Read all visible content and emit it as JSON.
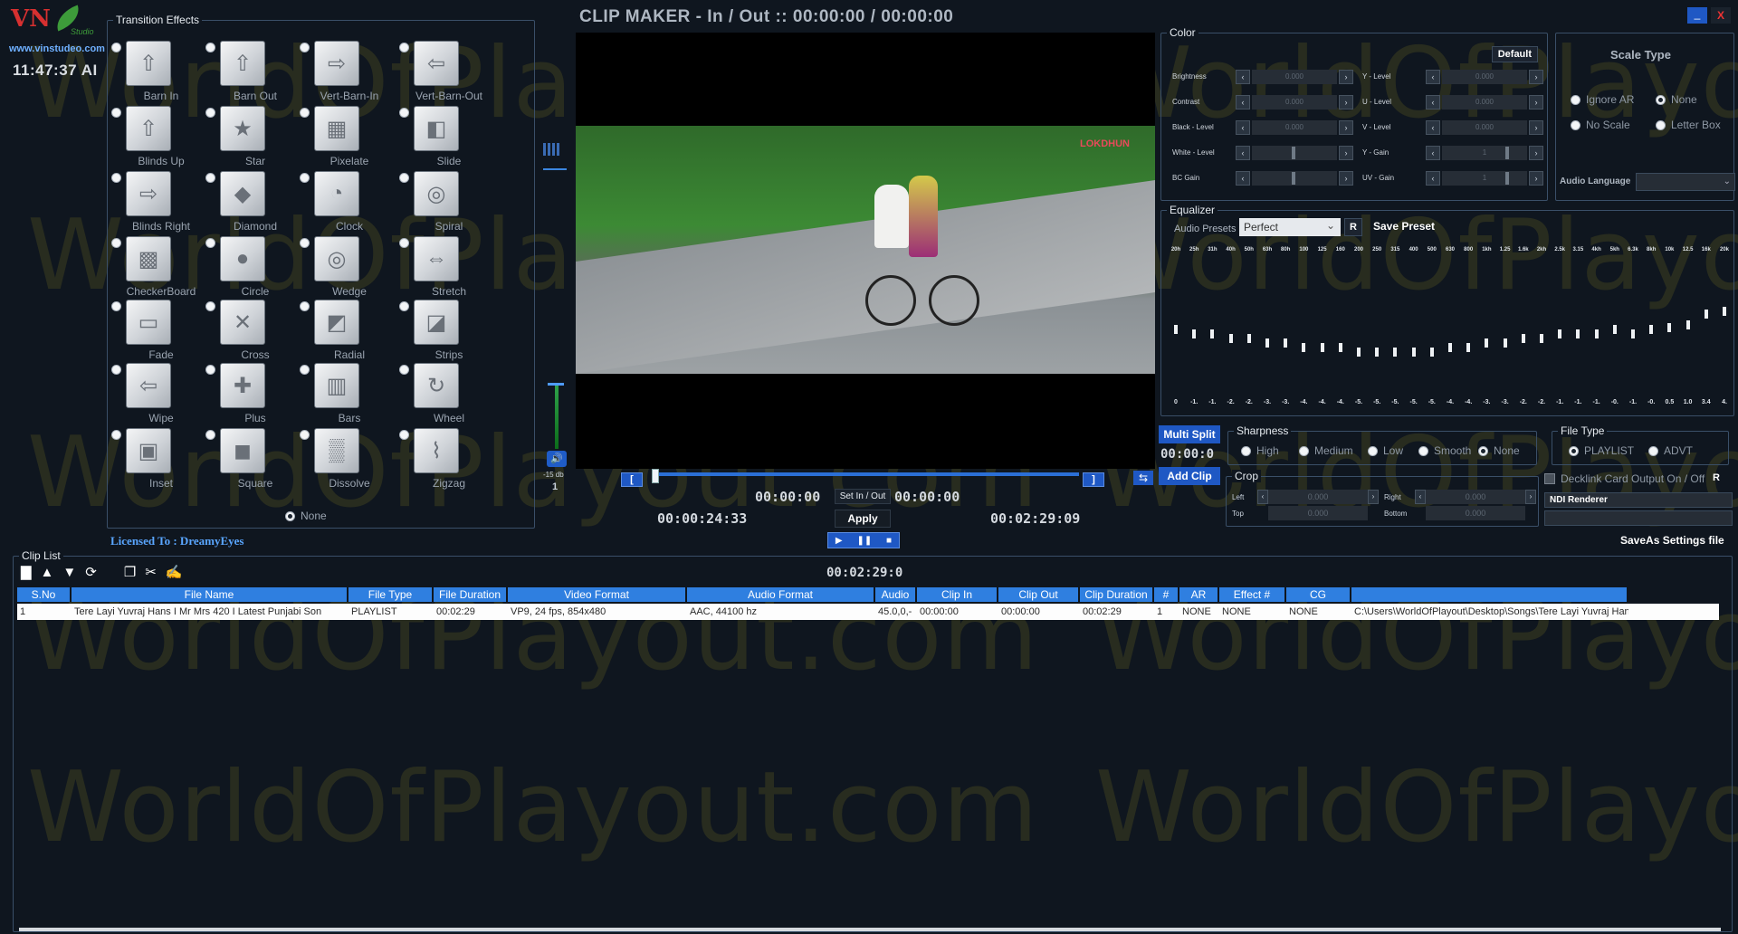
{
  "app": {
    "title": "CLIP MAKER  -  In / Out  ::  00:00:00 / 00:00:00",
    "logo_text": "VN",
    "logo_sub": "Studio",
    "url": "www.vinstudeo.com",
    "clock": "11:47:37 AI",
    "licensed": "Licensed To : DreamyEyes",
    "watermark": "WorldOfPlayout.com",
    "accent": "#1f58c4",
    "header_blue": "#2f7fe0"
  },
  "transition_effects": {
    "legend": "Transition Effects",
    "items": [
      {
        "label": "Barn In",
        "icon": "arrow-up-icon"
      },
      {
        "label": "Barn Out",
        "icon": "arrow-up-icon"
      },
      {
        "label": "Vert-Barn-In",
        "icon": "arrow-right-icon"
      },
      {
        "label": "Vert-Barn-Out",
        "icon": "arrow-left-icon"
      },
      {
        "label": "Blinds Up",
        "icon": "arrow-up-icon"
      },
      {
        "label": "Star",
        "icon": "star-icon"
      },
      {
        "label": "Pixelate",
        "icon": "checker-icon"
      },
      {
        "label": "Slide",
        "icon": "slide-icon"
      },
      {
        "label": "Blinds Right",
        "icon": "arrow-right-icon"
      },
      {
        "label": "Diamond",
        "icon": "diamond-icon"
      },
      {
        "label": "Clock",
        "icon": "clock-icon"
      },
      {
        "label": "Spiral",
        "icon": "spiral-icon"
      },
      {
        "label": "CheckerBoard",
        "icon": "checkerboard-icon"
      },
      {
        "label": "Circle",
        "icon": "circle-icon"
      },
      {
        "label": "Wedge",
        "icon": "wedge-icon"
      },
      {
        "label": "Stretch",
        "icon": "stretch-icon"
      },
      {
        "label": "Fade",
        "icon": "fade-icon"
      },
      {
        "label": "Cross",
        "icon": "cross-icon"
      },
      {
        "label": "Radial",
        "icon": "radial-icon"
      },
      {
        "label": "Strips",
        "icon": "strips-icon"
      },
      {
        "label": "Wipe",
        "icon": "arrow-left-icon"
      },
      {
        "label": "Plus",
        "icon": "plus-icon"
      },
      {
        "label": "Bars",
        "icon": "bars-icon"
      },
      {
        "label": "Wheel",
        "icon": "wheel-icon"
      },
      {
        "label": "Inset",
        "icon": "inset-icon"
      },
      {
        "label": "Square",
        "icon": "square-icon"
      },
      {
        "label": "Dissolve",
        "icon": "dissolve-icon"
      },
      {
        "label": "Zigzag",
        "icon": "zigzag-icon"
      }
    ],
    "none_label": "None"
  },
  "video": {
    "channel_logo": "LOKDHUN"
  },
  "audio_meter": {
    "db_label": "-15 db",
    "level": "1"
  },
  "transport": {
    "in_marker": "[",
    "out_marker": "]",
    "clip_in_tc": "00:00:00",
    "clip_out_tc": "00:00:00",
    "set_in_out": "Set In / Out",
    "current_tc": "00:00:24:33",
    "duration_tc": "00:02:29:09",
    "apply": "Apply",
    "play": "▶",
    "pause": "❚❚",
    "stop": "■",
    "multi_split": "Multi Split",
    "split_tc": "00:00:0",
    "add_clip": "Add Clip"
  },
  "color": {
    "legend": "Color",
    "default": "Default",
    "left": [
      {
        "label": "Brightness",
        "value": "0.000"
      },
      {
        "label": "Contrast",
        "value": "0.000"
      },
      {
        "label": "Black - Level",
        "value": "0.000"
      },
      {
        "label": "White - Level",
        "value": ""
      },
      {
        "label": "BC Gain",
        "value": ""
      }
    ],
    "right": [
      {
        "label": "Y - Level",
        "value": "0.000"
      },
      {
        "label": "U - Level",
        "value": "0.000"
      },
      {
        "label": "V - Level",
        "value": "0.000"
      },
      {
        "label": "Y - Gain",
        "value": "1"
      },
      {
        "label": "UV - Gain",
        "value": "1"
      }
    ]
  },
  "scale_type": {
    "title": "Scale Type",
    "options": [
      "Ignore AR",
      "None",
      "No Scale",
      "Letter Box"
    ],
    "selected": "None",
    "audio_language_label": "Audio Language",
    "audio_language_value": "⌄"
  },
  "equalizer": {
    "legend": "Equalizer",
    "presets_label": "Audio Presets",
    "preset": "Perfect",
    "r": "R",
    "save_preset": "Save Preset",
    "bands": [
      "20h",
      "25h",
      "31h",
      "40h",
      "50h",
      "63h",
      "80h",
      "100",
      "125",
      "160",
      "200",
      "250",
      "315",
      "400",
      "500",
      "630",
      "800",
      "1kh",
      "1.25",
      "1.6k",
      "2kh",
      "2.5k",
      "3.15",
      "4kh",
      "5kh",
      "6.3k",
      "8kh",
      "10k",
      "12.5",
      "16k",
      "20k"
    ],
    "values": [
      "0",
      "-1.",
      "-1.",
      "-2.",
      "-2.",
      "-3.",
      "-3.",
      "-4.",
      "-4.",
      "-4.",
      "-5.",
      "-5.",
      "-5.",
      "-5.",
      "-5.",
      "-4.",
      "-4.",
      "-3.",
      "-3.",
      "-2.",
      "-2.",
      "-1.",
      "-1.",
      "-1.",
      "-0.",
      "-1.",
      "-0.",
      "0.5",
      "1.0",
      "3.4",
      "4."
    ]
  },
  "sharpness": {
    "legend": "Sharpness",
    "options": [
      "High",
      "Medium",
      "Low",
      "Smooth",
      "None"
    ],
    "selected": "None"
  },
  "file_type": {
    "legend": "File Type",
    "options": [
      "PLAYLIST",
      "ADVT"
    ],
    "selected": "PLAYLIST"
  },
  "crop": {
    "legend": "Crop",
    "left": "Left",
    "top": "Top",
    "right": "Right",
    "bottom": "Bottom",
    "value": "0.000"
  },
  "output": {
    "decklink": "Decklink Card Output On / Off",
    "r": "R",
    "renderer": "NDI Renderer",
    "saveas": "SaveAs Settings file"
  },
  "clip_list": {
    "legend": "Clip List",
    "total_tc": "00:02:29:0",
    "columns": [
      "S.No",
      "File Name",
      "File Type",
      "File Duration",
      "Video Format",
      "Audio Format",
      "Audio",
      "Clip In",
      "Clip Out",
      "Clip Duration",
      "#",
      "AR",
      "Effect #",
      "CG",
      ""
    ],
    "rows": [
      [
        "1",
        "Tere Layi Yuvraj Hans I Mr Mrs 420 I Latest Punjabi Son",
        "PLAYLIST",
        "00:02:29",
        "VP9, 24 fps, 854x480",
        "AAC, 44100 hz",
        "45.0,0,-",
        "00:00:00",
        "00:00:00",
        "00:02:29",
        "1",
        "NONE",
        "NONE",
        "NONE",
        "C:\\Users\\WorldOfPlayout\\Desktop\\Songs\\Tere Layi Yuvraj Hans I Mr"
      ]
    ]
  },
  "window": {
    "minimize": "_",
    "close": "X"
  }
}
